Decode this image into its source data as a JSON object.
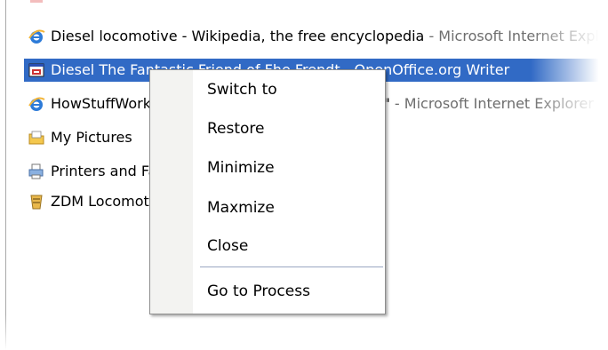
{
  "list": {
    "rows": [
      {
        "title": "Diesel locomotive - Wikipedia, the free encyclopedia",
        "app": " - Microsoft Internet Explorer",
        "icon": "internet-explorer-icon"
      },
      {
        "title": "Diesel The Fantastic Friend of Fhe Frendt - OpenOffice.org Writer",
        "app": "",
        "icon": "openoffice-writer-icon"
      },
      {
        "title": "HowStuffWorks \"How Diesel Locomotives Work\"",
        "app": " - Microsoft Internet Explorer",
        "icon": "internet-explorer-icon"
      },
      {
        "title": "My Pictures",
        "app": "",
        "icon": "folder-icon"
      },
      {
        "title": "Printers and Faxes",
        "app": "",
        "icon": "printer-icon"
      },
      {
        "title": "ZDM Locomotive",
        "app": "",
        "icon": "zdm-icon"
      }
    ]
  },
  "context_menu": {
    "items": [
      {
        "label": "Switch to"
      },
      {
        "label": "Restore"
      },
      {
        "label": "Minimize"
      },
      {
        "label": "Maxmize"
      },
      {
        "label": "Close"
      },
      {
        "label": "Go to Process"
      }
    ]
  },
  "colors": {
    "selection": "#316ac5",
    "menu_border": "#8e8e8e",
    "menu_gutter": "#f3f3f1"
  }
}
